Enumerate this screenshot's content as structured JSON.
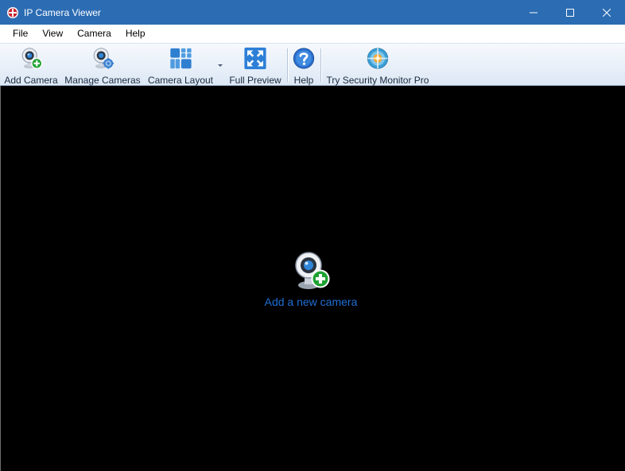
{
  "window": {
    "title": "IP Camera Viewer",
    "controls": {
      "minimize": "minimize-icon",
      "maximize": "maximize-icon",
      "close": "close-icon"
    }
  },
  "menubar": {
    "items": [
      "File",
      "View",
      "Camera",
      "Help"
    ]
  },
  "toolbar": {
    "add_camera": "Add Camera",
    "manage_cameras": "Manage Cameras",
    "camera_layout": "Camera Layout",
    "full_preview": "Full Preview",
    "help": "Help",
    "try_pro": "Try Security Monitor Pro"
  },
  "main": {
    "add_link": "Add a new camera"
  },
  "colors": {
    "titlebar": "#2b6cb3",
    "link": "#1e6fd6",
    "background": "#000000"
  }
}
